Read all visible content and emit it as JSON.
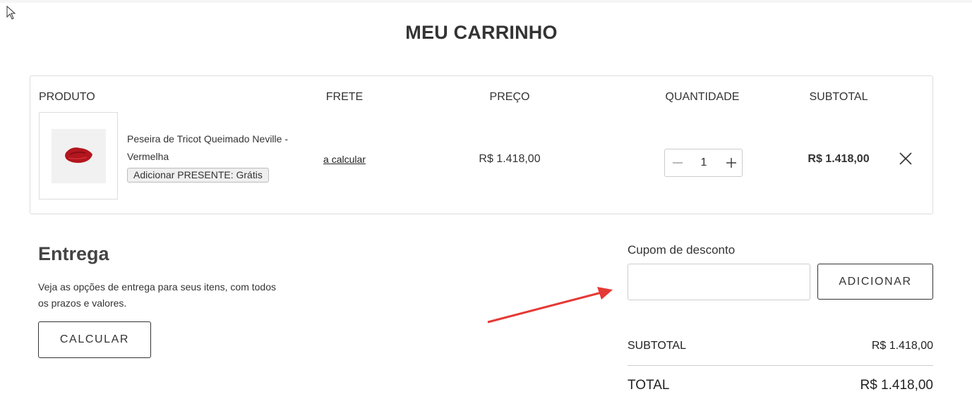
{
  "page": {
    "title": "MEU CARRINHO"
  },
  "cart": {
    "headers": {
      "product": "PRODUTO",
      "shipping": "FRETE",
      "price": "PREÇO",
      "quantity": "QUANTIDADE",
      "subtotal": "SUBTOTAL"
    },
    "item": {
      "name": "Peseira de Tricot Queimado Neville - Vermelha",
      "gift_button": "Adicionar PRESENTE: Grátis",
      "shipping": "a calcular",
      "price": "R$ 1.418,00",
      "quantity": "1",
      "subtotal": "R$ 1.418,00",
      "image_icon": "product-thumbnail",
      "remove_icon": "close-icon"
    }
  },
  "shipping": {
    "title": "Entrega",
    "description": "Veja as opções de entrega para seus itens, com todos os prazos e valores.",
    "button": "CALCULAR"
  },
  "coupon": {
    "label": "Cupom de desconto",
    "value": "",
    "placeholder": "",
    "button": "ADICIONAR"
  },
  "summary": {
    "subtotal_label": "SUBTOTAL",
    "subtotal_value": "R$ 1.418,00",
    "total_label": "TOTAL",
    "total_value": "R$ 1.418,00"
  },
  "colors": {
    "annotation_arrow": "#e53935",
    "product_red": "#b3161e",
    "border": "#dddddd"
  }
}
